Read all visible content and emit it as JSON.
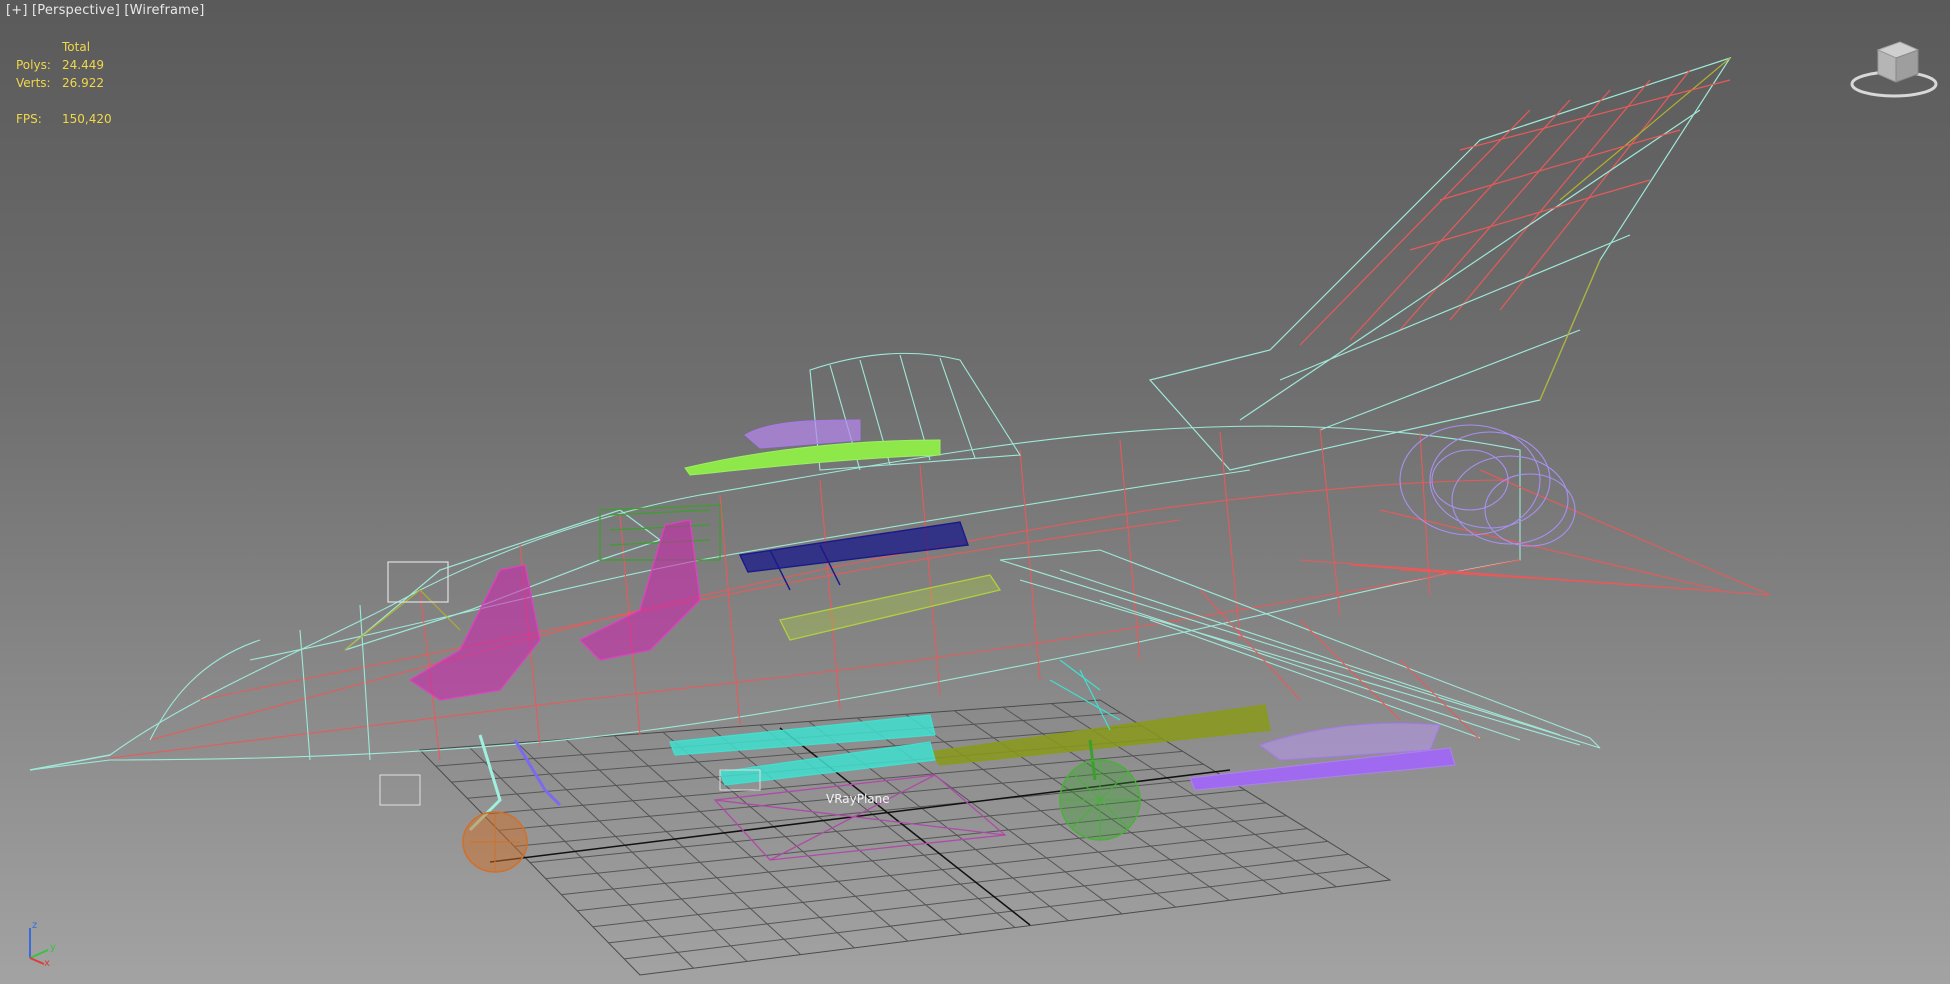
{
  "viewport": {
    "label_plus": "[+]",
    "label_view": "[Perspective]",
    "label_mode": "[Wireframe]"
  },
  "stats": {
    "total_header": "Total",
    "polys_label": "Polys:",
    "polys_value": "24.449",
    "verts_label": "Verts:",
    "verts_value": "26.922",
    "fps_label": "FPS:",
    "fps_value": "150,420"
  },
  "scene": {
    "helper_label": "VRayPlane"
  },
  "gizmo": {
    "z_label": "z",
    "y_label": "y",
    "x_label": "x"
  },
  "colors": {
    "wire_cyan": "#9fe8d8",
    "wire_red": "#e85a5a",
    "wire_magenta": "#d020b0",
    "wire_lime": "#8ee84a",
    "wire_olive": "#8a9a1a",
    "wire_purple": "#a878f0",
    "wire_navy": "#1a1a8a",
    "wire_turquoise": "#40e0d0",
    "wire_orange": "#d0702a",
    "wire_green": "#3aa02a",
    "grid": "#505050",
    "stats_text": "#f0d84a"
  }
}
